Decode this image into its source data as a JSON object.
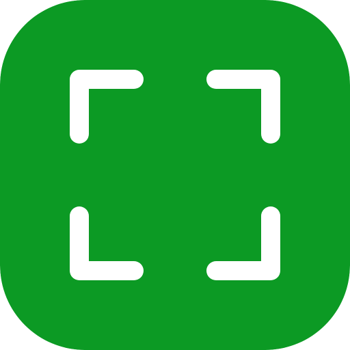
{
  "app_icon": {
    "icon": "fullscreen-scan-icon",
    "background_color": "#0c9a24",
    "glyph_color": "#ffffff"
  }
}
